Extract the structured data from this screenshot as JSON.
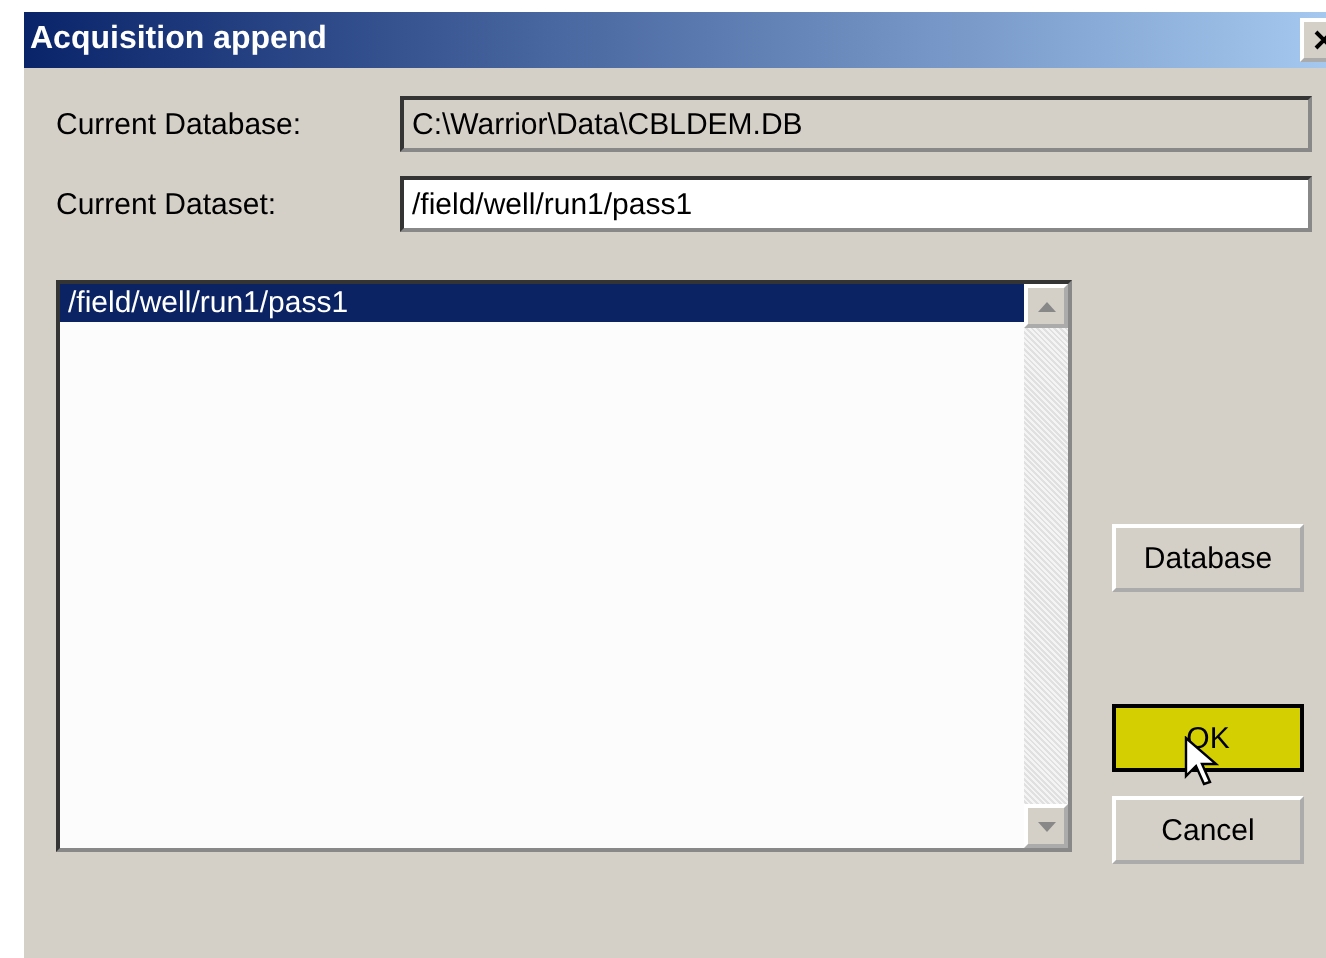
{
  "window": {
    "title": "Acquisition append"
  },
  "fields": [
    {
      "label": "Current Database:",
      "value": "C:\\Warrior\\Data\\CBLDEM.DB",
      "disabled": true
    },
    {
      "label": "Current Dataset:",
      "value": "/field/well/run1/pass1",
      "disabled": false
    }
  ],
  "list": {
    "items": [
      {
        "text": "/field/well/run1/pass1",
        "selected": true
      }
    ]
  },
  "buttons": [
    {
      "label": "Database",
      "highlighted": false
    },
    {
      "label": "OK",
      "highlighted": true
    },
    {
      "label": "Cancel",
      "highlighted": false
    }
  ]
}
